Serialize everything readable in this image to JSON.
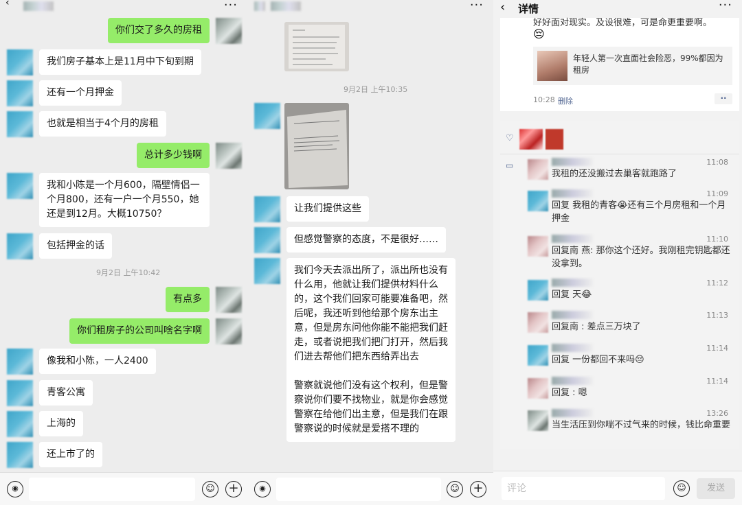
{
  "panel1": {
    "messages": [
      {
        "side": "right",
        "text": "你们交了多久的房租"
      },
      {
        "side": "left",
        "text": "我们房子基本上是11月中下旬到期"
      },
      {
        "side": "left",
        "text": "还有一个月押金"
      },
      {
        "side": "left",
        "text": "也就是相当于4个月的房租"
      },
      {
        "side": "right",
        "text": "总计多少钱啊"
      },
      {
        "side": "left",
        "text": "我和小陈是一个月600，隔壁情侣一个月800，还有一户一个月550，她还是到12月。大概10750？"
      },
      {
        "side": "left",
        "text": "包括押金的话"
      },
      {
        "side": "right",
        "text": "有点多"
      },
      {
        "side": "right",
        "text": "你们租房子的公司叫啥名字啊"
      },
      {
        "side": "left",
        "text": "像我和小陈，一人2400"
      },
      {
        "side": "left",
        "text": "青客公寓"
      },
      {
        "side": "left",
        "text": "上海的"
      },
      {
        "side": "left",
        "text": "还上市了的"
      }
    ],
    "timestamp": "9月2日 上午10:42"
  },
  "panel2": {
    "timestamp": "9月2日 上午10:35",
    "messages": [
      {
        "side": "left",
        "text": "让我们提供这些"
      },
      {
        "side": "left",
        "text": "但感觉警察的态度，不是很好……"
      },
      {
        "side": "left",
        "text": "我们今天去派出所了，派出所也没有什么用，他就让我们提供材料什么的，这个我们回家可能要准备吧，然后呢，我还听到他给那个房东出主意，但是房东问他你能不能把我们赶走，或者说把我们把门打开，然后我们进去帮他们把东西给弄出去\n\n警察就说他们没有这个权利，但是警察说你们要不找物业，就是你会感觉警察在给他们出主意，但是我们在跟警察说的时候就是爱搭不理的"
      }
    ]
  },
  "panel3": {
    "title": "详情",
    "top_text": "好好面对现实。及设很难，可是命更重要啊。",
    "link_card": {
      "text": "年轻人第一次直面社会险恶，99%都因为租房"
    },
    "post_time": "10:28",
    "delete_label": "删除",
    "comments": [
      {
        "time": "11:08",
        "text": "我租的还没搬过去巢客就跑路了"
      },
      {
        "time": "11:09",
        "text": "回复 我租的青客😭还有三个月房租和一个月押金"
      },
      {
        "time": "11:10",
        "text": "回复南 燕: 那你这个还好。我刚租完钥匙都还没拿到。"
      },
      {
        "time": "11:12",
        "text": "回复 天😂"
      },
      {
        "time": "11:13",
        "text": "回复南 : 差点三万块了"
      },
      {
        "time": "11:14",
        "text": "回复 一份都回不来吗😔"
      },
      {
        "time": "11:14",
        "text": "回复 : 嗯"
      },
      {
        "time": "13:26",
        "text": "当生活压到你喘不过气来的时候，钱比命重要"
      }
    ],
    "comment_placeholder": "评论",
    "send_label": "发送"
  },
  "icons": {
    "more": "more-icon",
    "voice": "voice-icon",
    "emoji": "emoji-icon",
    "plus": "plus-icon",
    "back": "back-icon",
    "heart": "heart-icon",
    "comment": "comment-icon"
  },
  "colors": {
    "bubble_right": "#95ec69",
    "bubble_left": "#ffffff",
    "background": "#ededed"
  }
}
